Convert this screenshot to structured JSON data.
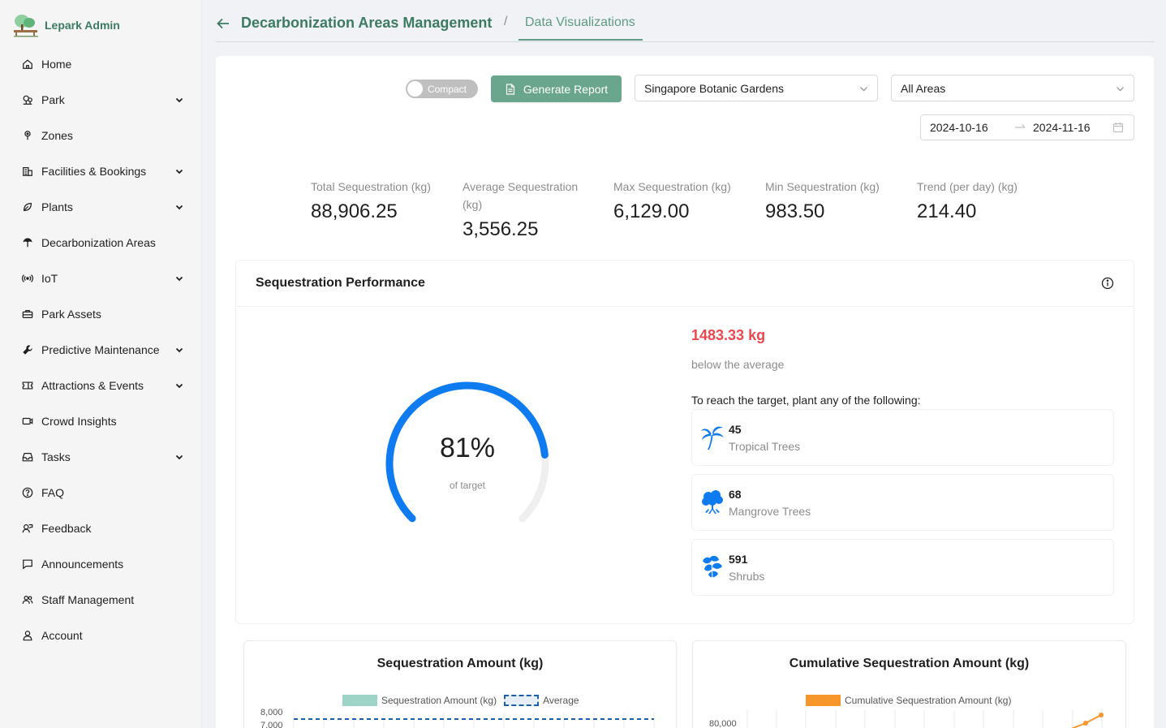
{
  "brand": {
    "name": "Lepark Admin"
  },
  "sidebar": {
    "items": [
      {
        "label": "Home",
        "icon": "home-icon",
        "expandable": false
      },
      {
        "label": "Park",
        "icon": "park-icon",
        "expandable": true
      },
      {
        "label": "Zones",
        "icon": "zone-pin-icon",
        "expandable": false
      },
      {
        "label": "Facilities & Bookings",
        "icon": "building-icon",
        "expandable": true
      },
      {
        "label": "Plants",
        "icon": "leaf-icon",
        "expandable": true
      },
      {
        "label": "Decarbonization Areas",
        "icon": "umbrella-tree-icon",
        "expandable": false
      },
      {
        "label": "IoT",
        "icon": "broadcast-icon",
        "expandable": true
      },
      {
        "label": "Park Assets",
        "icon": "toolbox-icon",
        "expandable": false
      },
      {
        "label": "Predictive Maintenance",
        "icon": "wrench-icon",
        "expandable": true
      },
      {
        "label": "Attractions & Events",
        "icon": "ticket-icon",
        "expandable": true
      },
      {
        "label": "Crowd Insights",
        "icon": "video-camera-icon",
        "expandable": false
      },
      {
        "label": "Tasks",
        "icon": "inbox-icon",
        "expandable": true
      },
      {
        "label": "FAQ",
        "icon": "question-circle-icon",
        "expandable": false
      },
      {
        "label": "Feedback",
        "icon": "feedback-user-icon",
        "expandable": false
      },
      {
        "label": "Announcements",
        "icon": "message-icon",
        "expandable": false
      },
      {
        "label": "Staff Management",
        "icon": "team-icon",
        "expandable": false
      },
      {
        "label": "Account",
        "icon": "user-icon",
        "expandable": false
      }
    ]
  },
  "header": {
    "title": "Decarbonization Areas Management",
    "separator": "/",
    "active_tab": "Data Visualizations"
  },
  "toolbar": {
    "toggle_label": "Compact",
    "toggle_on": false,
    "generate_label": "Generate Report",
    "park_select": "Singapore Botanic Gardens",
    "area_select": "All Areas",
    "date_start": "2024-10-16",
    "date_end": "2024-11-16"
  },
  "stats": [
    {
      "label": "Total Sequestration (kg)",
      "value": "88,906.25"
    },
    {
      "label": "Average Sequestration (kg)",
      "value": "3,556.25"
    },
    {
      "label": "Max Sequestration (kg)",
      "value": "6,129.00"
    },
    {
      "label": "Min Sequestration (kg)",
      "value": "983.50"
    },
    {
      "label": "Trend (per day) (kg)",
      "value": "214.40"
    }
  ],
  "performance": {
    "title": "Sequestration Performance",
    "percent": "81%",
    "percent_value": 0.81,
    "percent_sub": "of target",
    "below_value": "1483.33 kg",
    "below_text": "below the average",
    "reach_text": "To reach the target, plant any of the following:",
    "plants": [
      {
        "count": "45",
        "name": "Tropical Trees",
        "icon": "palm-tree-icon"
      },
      {
        "count": "68",
        "name": "Mangrove Trees",
        "icon": "mangrove-tree-icon"
      },
      {
        "count": "591",
        "name": "Shrubs",
        "icon": "shrub-leaves-icon"
      }
    ]
  },
  "charts": {
    "amount": {
      "title": "Sequestration Amount (kg)",
      "legend_series": "Sequestration Amount (kg)",
      "legend_average": "Average",
      "y_ticks": [
        "8,000",
        "7,000"
      ]
    },
    "cumulative": {
      "title": "Cumulative Sequestration Amount (kg)",
      "legend_series": "Cumulative Sequestration Amount (kg)",
      "y_ticks": [
        "80,000"
      ]
    }
  },
  "colors": {
    "brand_green": "#3d7a62",
    "button_green": "#6aa58d",
    "gauge_blue": "#0f7bf1",
    "alert_red": "#e9484f",
    "cumulative_orange": "#f7962b",
    "amount_teal": "#9ed4c8"
  }
}
